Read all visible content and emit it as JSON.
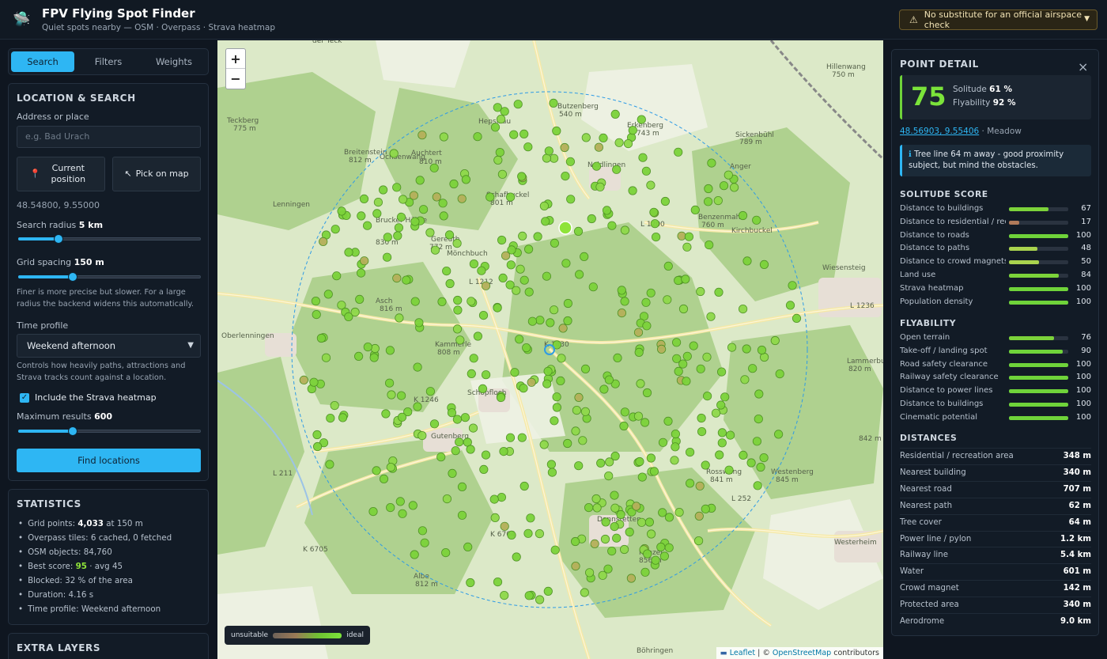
{
  "header": {
    "title": "FPV Flying Spot Finder",
    "subtitle": "Quiet spots nearby — OSM · Overpass · Strava heatmap",
    "logo_icon": "ufo-icon",
    "airspace_notice": "No substitute for an official airspace check",
    "airspace_icon": "warning-icon"
  },
  "sidebar": {
    "tabs": [
      {
        "label": "Search",
        "active": true
      },
      {
        "label": "Filters",
        "active": false
      },
      {
        "label": "Weights",
        "active": false
      }
    ],
    "search": {
      "title": "LOCATION & SEARCH",
      "address_label": "Address or place",
      "address_placeholder": "e.g. Bad Urach",
      "current_position_label": "Current position",
      "pick_on_map_label": "Pick on map",
      "coordinates": "48.54800, 9.55000",
      "radius_label": "Search radius",
      "radius_value": "5 km",
      "radius_fraction": 0.22,
      "grid_label": "Grid spacing",
      "grid_value": "150 m",
      "grid_fraction": 0.3,
      "grid_hint": "Finer is more precise but slower. For a large radius the backend widens this automatically.",
      "time_profile_label": "Time profile",
      "time_profile_value": "Weekend afternoon",
      "time_profile_hint": "Controls how heavily paths, attractions and Strava tracks count against a location.",
      "strava_label": "Include the Strava heatmap",
      "strava_checked": true,
      "max_results_label": "Maximum results",
      "max_results_value": "600",
      "max_results_fraction": 0.3,
      "find_button": "Find locations"
    },
    "statistics": {
      "title": "STATISTICS",
      "grid_points_prefix": "Grid points:",
      "grid_points_value": "4,033",
      "grid_points_suffix": "at 150 m",
      "overpass_tiles": "Overpass tiles: 6 cached, 0 fetched",
      "osm_objects": "OSM objects: 84,760",
      "best_score_prefix": "Best score:",
      "best_score_value": "95",
      "best_score_suffix": "· avg 45",
      "blocked": "Blocked: 32 % of the area",
      "duration": "Duration: 4.16 s",
      "time_profile": "Time profile: Weekend afternoon"
    },
    "extra_layers": {
      "title": "EXTRA LAYERS"
    }
  },
  "map": {
    "zoom_in": "+",
    "zoom_out": "−",
    "legend_low": "unsuitable",
    "legend_high": "ideal",
    "attribution_leaflet": "Leaflet",
    "attribution_sep": "| ©",
    "attribution_osm": "OpenStreetMap",
    "attribution_suffix": "contributors",
    "place_labels": [
      "der Teck",
      "Hepsisau",
      "Butzenberg",
      "540 m",
      "Erkenberg",
      "743 m",
      "Sickenbühl",
      "789 m",
      "Hillenwang",
      "750 m",
      "Teckberg",
      "775 m",
      "Breitenstein",
      "812 m",
      "Ochsenwang",
      "Auchtert",
      "810 m",
      "Neidlingen",
      "Anger",
      "Schafbuckel",
      "801 m",
      "Benzenmahd",
      "760 m",
      "Kirchbuckel",
      "Wiesensteig",
      "Brucker Hölzle",
      "830 m",
      "Gereuth",
      "772 m",
      "Mönchbuch",
      "L 1200",
      "L 1212",
      "L 1236",
      "Oberlenningen",
      "Asch",
      "816 m",
      "K 1430",
      "Kammerle",
      "808 m",
      "Lammerbuckel",
      "820 m",
      "Schopfloch",
      "K 1246",
      "Gutenberg",
      "L 211",
      "K 6705",
      "K 6704",
      "Donnstetten",
      "Rosswang",
      "841 m",
      "Westenberg",
      "845 m",
      "L 252",
      "Westerheim",
      "Kanzel",
      "856 m",
      "Albe",
      "812 m",
      "Böhringen",
      "842 m",
      "Lenningen"
    ],
    "marker_color": "#7cd33a",
    "radius_circle_color": "#2e9be6"
  },
  "detail": {
    "title": "POINT DETAIL",
    "score": "75",
    "solitude_label": "Solitude",
    "solitude_value": "61 %",
    "flyability_label": "Flyability",
    "flyability_value": "92 %",
    "coords": "48.56903, 9.55406",
    "landuse": "· Meadow",
    "info": "Tree line 64 m away - good proximity subject, but mind the obstacles.",
    "solitude_title": "SOLITUDE SCORE",
    "solitude_rows": [
      {
        "name": "Distance to buildings",
        "value": 67,
        "color": "#7cd33a"
      },
      {
        "name": "Distance to residential / recreation area",
        "value": 17,
        "color": "#b07a5a"
      },
      {
        "name": "Distance to roads",
        "value": 100,
        "color": "#6fd33a"
      },
      {
        "name": "Distance to paths",
        "value": 48,
        "color": "#a9d34e"
      },
      {
        "name": "Distance to crowd magnets",
        "value": 50,
        "color": "#a9d34e"
      },
      {
        "name": "Land use",
        "value": 84,
        "color": "#7cd33a"
      },
      {
        "name": "Strava heatmap",
        "value": 100,
        "color": "#6fd33a"
      },
      {
        "name": "Population density",
        "value": 100,
        "color": "#6fd33a"
      }
    ],
    "flyability_title": "FLYABILITY",
    "flyability_rows": [
      {
        "name": "Open terrain",
        "value": 76,
        "color": "#7cd33a"
      },
      {
        "name": "Take-off / landing spot",
        "value": 90,
        "color": "#6fd33a"
      },
      {
        "name": "Road safety clearance",
        "value": 100,
        "color": "#6fd33a"
      },
      {
        "name": "Railway safety clearance",
        "value": 100,
        "color": "#6fd33a"
      },
      {
        "name": "Distance to power lines",
        "value": 100,
        "color": "#6fd33a"
      },
      {
        "name": "Distance to buildings",
        "value": 100,
        "color": "#6fd33a"
      },
      {
        "name": "Cinematic potential",
        "value": 100,
        "color": "#6fd33a"
      }
    ],
    "distances_title": "DISTANCES",
    "distances": [
      {
        "name": "Residential / recreation area",
        "value": "348 m"
      },
      {
        "name": "Nearest building",
        "value": "340 m"
      },
      {
        "name": "Nearest road",
        "value": "707 m"
      },
      {
        "name": "Nearest path",
        "value": "62 m"
      },
      {
        "name": "Tree cover",
        "value": "64 m"
      },
      {
        "name": "Power line / pylon",
        "value": "1.2 km"
      },
      {
        "name": "Railway line",
        "value": "5.4 km"
      },
      {
        "name": "Water",
        "value": "601 m"
      },
      {
        "name": "Crowd magnet",
        "value": "142 m"
      },
      {
        "name": "Protected area",
        "value": "340 m"
      },
      {
        "name": "Aerodrome",
        "value": "9.0 km"
      }
    ]
  }
}
